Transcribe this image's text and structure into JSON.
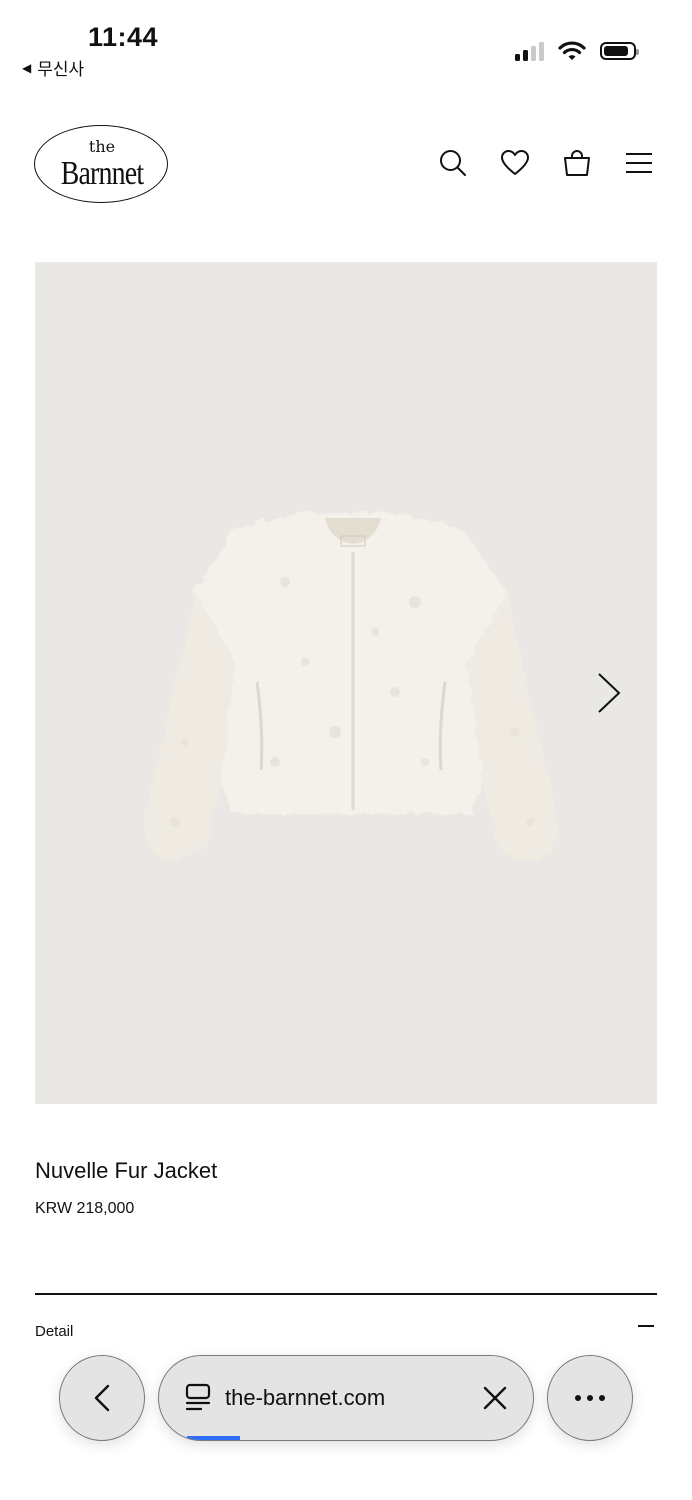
{
  "status_bar": {
    "time": "11:44",
    "back_app": "무신사",
    "back_icon": "back-triangle-icon",
    "icons": [
      "cellular-signal-icon",
      "wifi-icon",
      "battery-icon"
    ]
  },
  "header": {
    "logo_top": "the",
    "logo_main": "Barnnet",
    "icons": [
      "search-icon",
      "heart-icon",
      "bag-icon",
      "menu-icon"
    ]
  },
  "product": {
    "name": "Nuvelle Fur Jacket",
    "price": "KRW 218,000",
    "image_alt": "cream-fur-jacket-image",
    "image_bg": "#e9e8e4"
  },
  "accordion": {
    "detail_label": "Detail",
    "state": "expanded"
  },
  "browser": {
    "url": "the-barnnet.com",
    "progress": 0.14,
    "accent": "#2f6ff6"
  }
}
